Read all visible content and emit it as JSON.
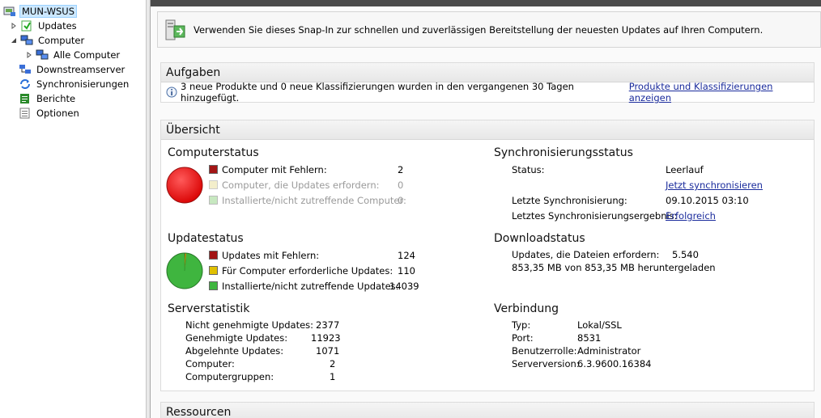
{
  "tree": {
    "root": "MUN-WSUS",
    "items": [
      {
        "label": "Updates"
      },
      {
        "label": "Computer"
      },
      {
        "label": "Alle Computer"
      },
      {
        "label": "Downstreamserver"
      },
      {
        "label": "Synchronisierungen"
      },
      {
        "label": "Berichte"
      },
      {
        "label": "Optionen"
      }
    ]
  },
  "banner": {
    "text": "Verwenden Sie dieses Snap-In zur schnellen und zuverlässigen Bereitstellung der neuesten Updates auf Ihren Computern."
  },
  "tasks": {
    "title": "Aufgaben",
    "message": "3 neue Produkte und 0 neue Klassifizierungen wurden in den vergangenen 30 Tagen hinzugefügt.",
    "link": "Produkte und Klassifizierungen anzeigen"
  },
  "overview": {
    "title": "Übersicht",
    "computerstatus": {
      "title": "Computerstatus",
      "rows": [
        {
          "label": "Computer mit Fehlern:",
          "value": "2",
          "color": "#a31515"
        },
        {
          "label": "Computer, die Updates erfordern:",
          "value": "0",
          "color": "#f3eecb"
        },
        {
          "label": "Installierte/nicht zutreffende Computer:",
          "value": "0",
          "color": "#c7e8c0"
        }
      ]
    },
    "updatestatus": {
      "title": "Updatestatus",
      "rows": [
        {
          "label": "Updates mit Fehlern:",
          "value": "124",
          "color": "#a31515"
        },
        {
          "label": "Für Computer erforderliche Updates:",
          "value": "110",
          "color": "#e0c000"
        },
        {
          "label": "Installierte/nicht zutreffende Updates:",
          "value": "14039",
          "color": "#3fb53f"
        }
      ]
    },
    "serverstatistik": {
      "title": "Serverstatistik",
      "rows": [
        {
          "label": "Nicht genehmigte Updates:",
          "value": "2377"
        },
        {
          "label": "Genehmigte Updates:",
          "value": "11923"
        },
        {
          "label": "Abgelehnte Updates:",
          "value": "1071"
        },
        {
          "label": "Computer:",
          "value": "2"
        },
        {
          "label": "Computergruppen:",
          "value": "1"
        }
      ]
    },
    "sync": {
      "title": "Synchronisierungsstatus",
      "status_label": "Status:",
      "status_value": "Leerlauf",
      "sync_now": "Jetzt synchronisieren",
      "last_label": "Letzte Synchronisierung:",
      "last_value": "09.10.2015 03:10",
      "result_label": "Letztes Synchronisierungsergebnis:",
      "result_value": "Erfolgreich"
    },
    "download": {
      "title": "Downloadstatus",
      "files_label": "Updates, die Dateien erfordern:",
      "files_value": "5.540",
      "progress_text": "853,35 MB von 853,35 MB heruntergeladen"
    },
    "connection": {
      "title": "Verbindung",
      "rows": [
        {
          "label": "Typ:",
          "value": "Lokal/SSL"
        },
        {
          "label": "Port:",
          "value": "8531"
        },
        {
          "label": "Benutzerrolle:",
          "value": "Administrator"
        },
        {
          "label": "Serverversion:",
          "value": "6.3.9600.16384"
        }
      ]
    }
  },
  "resources": {
    "title": "Ressourcen"
  }
}
